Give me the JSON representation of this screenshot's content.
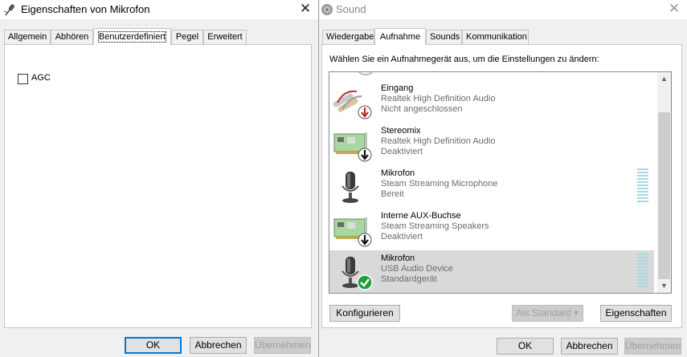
{
  "left_window": {
    "title": "Eigenschaften von Mikrofon",
    "close_glyph": "✕",
    "tabs": [
      {
        "label": "Allgemein"
      },
      {
        "label": "Abhören"
      },
      {
        "label": "Benutzerdefiniert"
      },
      {
        "label": "Pegel"
      },
      {
        "label": "Erweitert"
      }
    ],
    "active_tab": "Benutzerdefiniert",
    "agc_checkbox": {
      "label": "AGC",
      "checked": false
    },
    "buttons": {
      "ok": "OK",
      "cancel": "Abbrechen",
      "apply": "Übernehmen"
    }
  },
  "right_window": {
    "title": "Sound",
    "close_glyph": "✕",
    "tabs": [
      {
        "label": "Wiedergabe"
      },
      {
        "label": "Aufnahme"
      },
      {
        "label": "Sounds"
      },
      {
        "label": "Kommunikation"
      }
    ],
    "active_tab": "Aufnahme",
    "instruction": "Wählen Sie ein Aufnahmegerät aus, um die Einstellungen zu ändern:",
    "devices": [
      {
        "name": "Eingang",
        "driver": "Realtek High Definition Audio",
        "status": "Nicht angeschlossen",
        "icon": "line-in-jack-icon",
        "badge": "red-down-arrow",
        "meter": false,
        "selected": false
      },
      {
        "name": "Stereomix",
        "driver": "Realtek High Definition Audio",
        "status": "Deaktiviert",
        "icon": "sound-card-icon",
        "badge": "black-down-arrow",
        "meter": false,
        "selected": false
      },
      {
        "name": "Mikrofon",
        "driver": "Steam Streaming Microphone",
        "status": "Bereit",
        "icon": "microphone-icon",
        "badge": "none",
        "meter": true,
        "selected": false
      },
      {
        "name": "Interne AUX-Buchse",
        "driver": "Steam Streaming Speakers",
        "status": "Deaktiviert",
        "icon": "sound-card-icon",
        "badge": "black-down-arrow",
        "meter": false,
        "selected": false
      },
      {
        "name": "Mikrofon",
        "driver": "USB Audio Device",
        "status": "Standardgerät",
        "icon": "microphone-icon",
        "badge": "green-check",
        "meter": true,
        "selected": true
      }
    ],
    "buttons": {
      "configure": "Konfigurieren",
      "set_default": "Als Standard",
      "properties": "Eigenschaften",
      "ok": "OK",
      "cancel": "Abbrechen",
      "apply": "Übernehmen"
    }
  },
  "colors": {
    "selection": "#d9d9d9",
    "default_button_border": "#0078d7",
    "meter": "#a6d9e6",
    "badge_check": "#1e9e3a",
    "badge_red": "#d21c1c"
  }
}
